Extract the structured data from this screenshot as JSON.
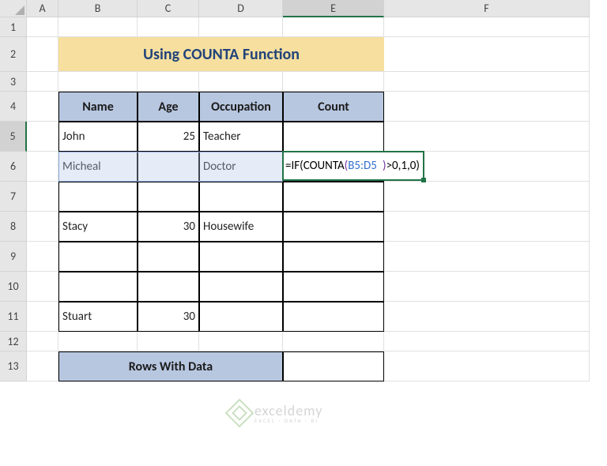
{
  "columns": [
    "A",
    "B",
    "C",
    "D",
    "E",
    "F"
  ],
  "rows": [
    "1",
    "2",
    "3",
    "4",
    "5",
    "6",
    "7",
    "8",
    "9",
    "10",
    "11",
    "12",
    "13"
  ],
  "title": "Using COUNTA Function",
  "headers": {
    "name": "Name",
    "age": "Age",
    "occupation": "Occupation",
    "count": "Count"
  },
  "data": [
    {
      "name": "John",
      "age": "25",
      "occupation": "Teacher"
    },
    {
      "name": "Micheal",
      "age": "",
      "occupation": "Doctor"
    },
    {
      "name": "",
      "age": "",
      "occupation": ""
    },
    {
      "name": "Stacy",
      "age": "30",
      "occupation": "Housewife"
    },
    {
      "name": "",
      "age": "",
      "occupation": ""
    },
    {
      "name": "",
      "age": "",
      "occupation": ""
    },
    {
      "name": "Stuart",
      "age": "30",
      "occupation": ""
    }
  ],
  "summary_label": "Rows With Data",
  "formula": {
    "eq": "=",
    "if": "IF",
    "counta": "COUNTA",
    "ref": "B5:D5",
    "tail": ">0,1,0"
  },
  "watermark": {
    "brand": "exceldemy",
    "tagline": "EXCEL · DATA · BI"
  },
  "active_col": "E",
  "active_row": "5",
  "chart_data": {
    "type": "table",
    "title": "Using COUNTA Function",
    "columns": [
      "Name",
      "Age",
      "Occupation",
      "Count"
    ],
    "rows": [
      [
        "John",
        25,
        "Teacher",
        "=IF(COUNTA(B5:D5)>0,1,0)"
      ],
      [
        "Micheal",
        null,
        "Doctor",
        null
      ],
      [
        null,
        null,
        null,
        null
      ],
      [
        "Stacy",
        30,
        "Housewife",
        null
      ],
      [
        null,
        null,
        null,
        null
      ],
      [
        null,
        null,
        null,
        null
      ],
      [
        "Stuart",
        30,
        null,
        null
      ]
    ],
    "summary": {
      "label": "Rows With Data",
      "value": null
    }
  }
}
